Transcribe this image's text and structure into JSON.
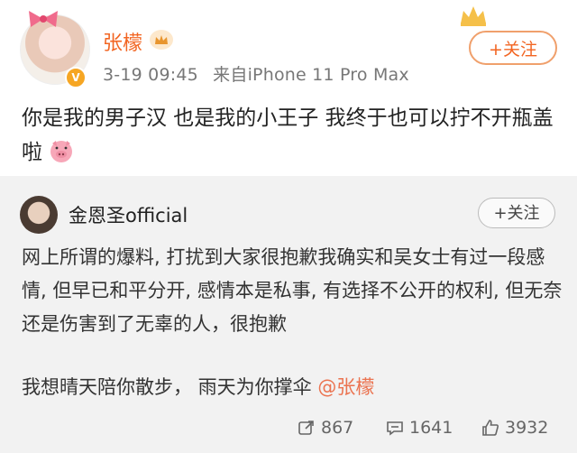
{
  "post": {
    "username": "张檬",
    "timestamp": "3-19 09:45",
    "source": "来自iPhone 11 Pro Max",
    "follow_label": "+关注",
    "text": "你是我的男子汉  也是我的小王子  我终于也可以拧不开瓶盖啦"
  },
  "repost": {
    "username": "金恩圣official",
    "follow_label": "+关注",
    "text": "网上所谓的爆料, 打扰到大家很抱歉我确实和吴女士有过一段感情, 但早已和平分开, 感情本是私事, 有选择不公开的权利, 但无奈还是伤害到了无辜的人，很抱歉",
    "text2_prefix": "我想晴天陪你散步，  雨天为你撑伞",
    "mention": "@张檬",
    "stats": {
      "reposts": "867",
      "comments": "1641",
      "likes": "3932"
    }
  },
  "icons": [
    "crown-icon",
    "verified-badge-icon",
    "pig-emoji-icon",
    "repost-icon",
    "comment-icon",
    "like-icon"
  ],
  "colors": {
    "accent": "#f26522",
    "mention": "#eb7350",
    "repost_bg": "#f2f2f2"
  }
}
